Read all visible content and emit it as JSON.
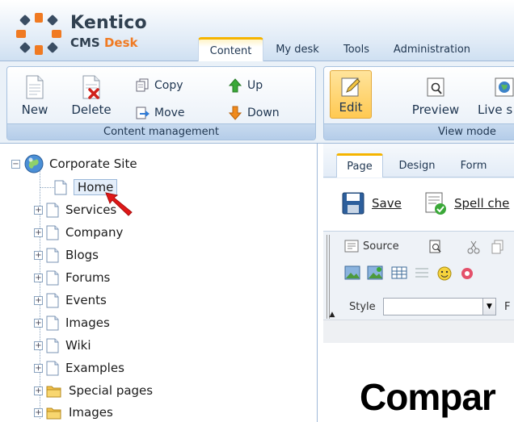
{
  "brand": {
    "name": "Kentico",
    "product_prefix": "CMS ",
    "product_accent": "Desk"
  },
  "main_tabs": [
    {
      "label": "Content",
      "active": true
    },
    {
      "label": "My desk",
      "active": false
    },
    {
      "label": "Tools",
      "active": false
    },
    {
      "label": "Administration",
      "active": false
    }
  ],
  "ribbon": {
    "content_management": {
      "caption": "Content management",
      "new_label": "New",
      "delete_label": "Delete",
      "copy_label": "Copy",
      "move_label": "Move",
      "up_label": "Up",
      "down_label": "Down"
    },
    "view_mode": {
      "caption": "View mode",
      "edit_label": "Edit",
      "preview_label": "Preview",
      "live_label": "Live s"
    }
  },
  "tree": {
    "root": "Corporate Site",
    "items": [
      {
        "label": "Home",
        "selected": true
      },
      {
        "label": "Services"
      },
      {
        "label": "Company"
      },
      {
        "label": "Blogs"
      },
      {
        "label": "Forums"
      },
      {
        "label": "Events"
      },
      {
        "label": "Images"
      },
      {
        "label": "Wiki"
      },
      {
        "label": "Examples"
      },
      {
        "label": "Special pages"
      },
      {
        "label": "Images"
      }
    ]
  },
  "editor": {
    "tabs": [
      {
        "label": "Page",
        "active": true
      },
      {
        "label": "Design",
        "active": false
      },
      {
        "label": "Form",
        "active": false
      }
    ],
    "save_label": "Save",
    "spell_label": "Spell che",
    "source_label": "Source",
    "style_label": "Style",
    "font_label": "F",
    "content_heading": "Compar"
  },
  "colors": {
    "accent": "#f5b400",
    "brand_orange": "#f07a22",
    "frame": "#9fb9d8"
  }
}
